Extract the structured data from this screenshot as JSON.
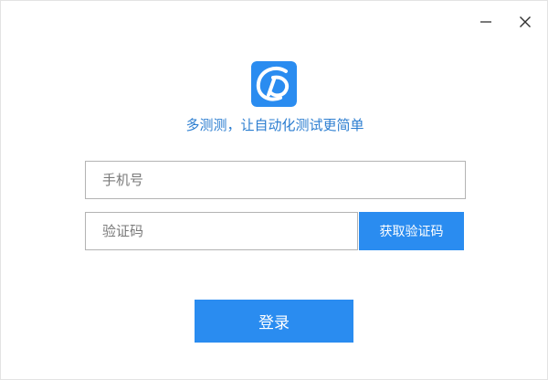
{
  "window_controls": {
    "minimize_icon": "minimize-icon",
    "close_icon": "close-icon"
  },
  "brand": {
    "logo_icon": "app-logo-icon",
    "slogan": "多测测，让自动化测试更简单"
  },
  "form": {
    "phone_placeholder": "手机号",
    "phone_value": "",
    "code_placeholder": "验证码",
    "code_value": "",
    "get_code_label": "获取验证码",
    "login_label": "登录"
  },
  "colors": {
    "accent": "#2a8cf0",
    "slogan": "#2b7dd0"
  }
}
